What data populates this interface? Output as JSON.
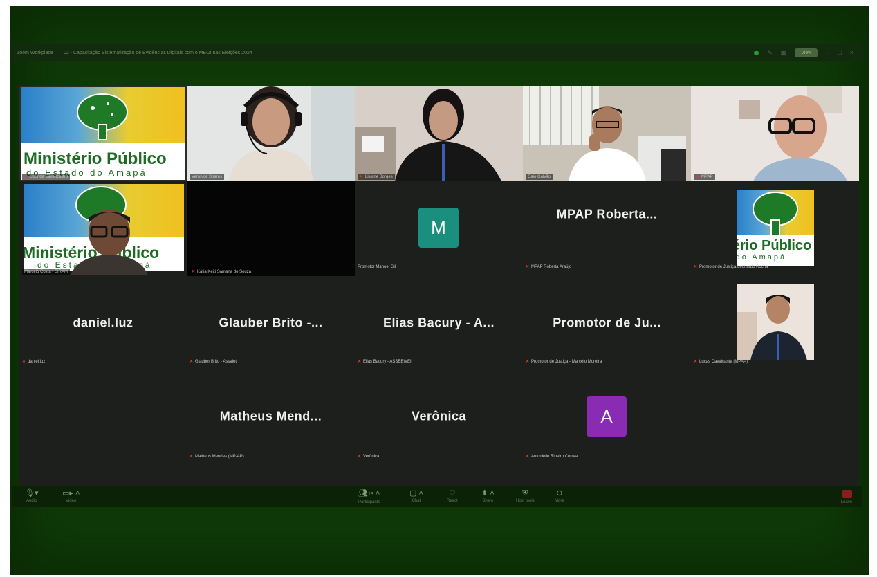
{
  "window": {
    "brand": "Zoom Workplace",
    "meeting_title": "02 - Capacitação Sistematização de Evidências Digitais com o MEOI nas Eleições 2024",
    "view_label": "View"
  },
  "logo": {
    "line1": "Ministério Público",
    "line2": "do Estado do Amapá"
  },
  "tiles": {
    "t1": {
      "label": "Lucinda Silva Castro"
    },
    "t2": {
      "label": "Veronice Soares"
    },
    "t3": {
      "label": "Lisiane Borges"
    },
    "t4": {
      "label": "Caio Galvão"
    },
    "t5": {
      "label": "MPAP"
    },
    "t6": {
      "label": "Marcelo Costa - SIRAM"
    },
    "t7": {
      "label": "Kátia Keiti Santana de Souza"
    },
    "t8": {
      "letter": "M",
      "label": "Promotor Manoel Gil",
      "color": "#1a8f7e"
    },
    "t9": {
      "name": "MPAP  Roberta...",
      "label": "MPAP Roberta Araújo"
    },
    "t10": {
      "label": "Promotor de Justiça Leonardo Rocha"
    },
    "t11": {
      "name": "daniel.luz",
      "label": "daniel.luz"
    },
    "t12": {
      "name": "Glauber  Brito  -...",
      "label": "Glauber Brito - Assaleti"
    },
    "t13": {
      "name": "Elias  Bacury  -  A...",
      "label": "Elias Bacury - ASSEBIVEI"
    },
    "t14": {
      "name": "Promotor  de  Ju...",
      "label": "Promotor de Justiça - Marcelo Moreira"
    },
    "t15": {
      "label": "Lucas Cavalcante (MPAP)"
    },
    "t16": {
      "name": "Matheus  Mend...",
      "label": "Matheus Mendes (MP-AP)"
    },
    "t17": {
      "name": "Verônica",
      "label": "Verônica"
    },
    "t18": {
      "letter": "A",
      "label": "Antonielle Ribeiro Correa",
      "color": "#8a2bb4"
    }
  },
  "toolbar": {
    "audio": "Audio",
    "video": "Video",
    "participants": "Participants",
    "participants_count": "18",
    "chat": "Chat",
    "react": "React",
    "share": "Share",
    "host_tools": "Host tools",
    "more": "More",
    "leave": "Leave"
  }
}
